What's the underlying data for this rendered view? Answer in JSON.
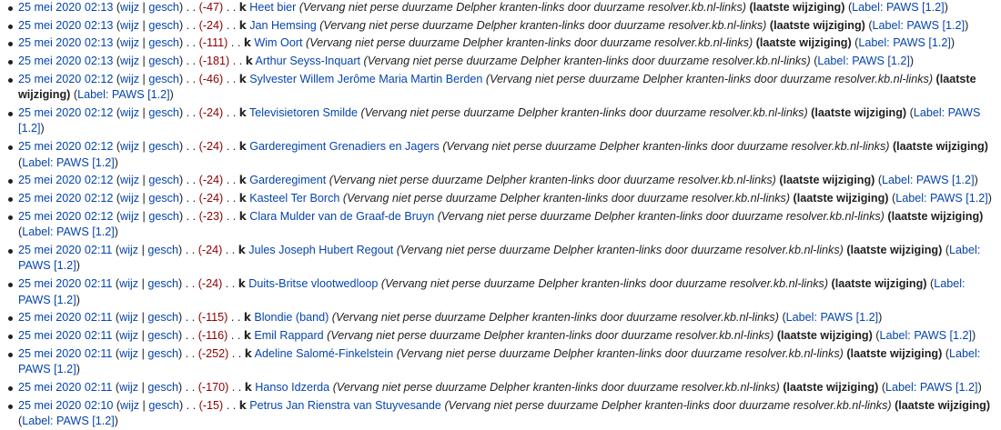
{
  "labels": {
    "diff": "wijz",
    "hist": "gesch",
    "minor": "k",
    "current": "(laatste wijziging)",
    "comment": "(Vervang niet perse duurzame Delpher kranten-links door duurzame resolver.kb.nl-links)",
    "tag_prefix": "Label:",
    "tag": "PAWS [1.2]"
  },
  "colors": {
    "link": "#0645ad",
    "negative_size": "#8b0000",
    "text": "#202122"
  },
  "contributions": [
    {
      "date": "25 mei 2020 02:13",
      "size": "(-47)",
      "page": "Heet bier",
      "current": true
    },
    {
      "date": "25 mei 2020 02:13",
      "size": "(-24)",
      "page": "Jan Hemsing",
      "current": true
    },
    {
      "date": "25 mei 2020 02:13",
      "size": "(-111)",
      "page": "Wim Oort",
      "current": true
    },
    {
      "date": "25 mei 2020 02:13",
      "size": "(-181)",
      "page": "Arthur Seyss-Inquart",
      "current": false
    },
    {
      "date": "25 mei 2020 02:12",
      "size": "(-46)",
      "page": "Sylvester Willem Jerôme Maria Martin Berden",
      "current": true
    },
    {
      "date": "25 mei 2020 02:12",
      "size": "(-24)",
      "page": "Televisietoren Smilde",
      "current": true
    },
    {
      "date": "25 mei 2020 02:12",
      "size": "(-24)",
      "page": "Garderegiment Grenadiers en Jagers",
      "current": true
    },
    {
      "date": "25 mei 2020 02:12",
      "size": "(-24)",
      "page": "Garderegiment",
      "current": true
    },
    {
      "date": "25 mei 2020 02:12",
      "size": "(-24)",
      "page": "Kasteel Ter Borch",
      "current": true
    },
    {
      "date": "25 mei 2020 02:12",
      "size": "(-23)",
      "page": "Clara Mulder van de Graaf-de Bruyn",
      "current": true
    },
    {
      "date": "25 mei 2020 02:11",
      "size": "(-24)",
      "page": "Jules Joseph Hubert Regout",
      "current": true
    },
    {
      "date": "25 mei 2020 02:11",
      "size": "(-24)",
      "page": "Duits-Britse vlootwedloop",
      "current": true
    },
    {
      "date": "25 mei 2020 02:11",
      "size": "(-115)",
      "page": "Blondie (band)",
      "current": false
    },
    {
      "date": "25 mei 2020 02:11",
      "size": "(-116)",
      "page": "Emil Rappard",
      "current": true
    },
    {
      "date": "25 mei 2020 02:11",
      "size": "(-252)",
      "page": "Adeline Salomé-Finkelstein",
      "current": true
    },
    {
      "date": "25 mei 2020 02:11",
      "size": "(-170)",
      "page": "Hanso Idzerda",
      "current": true
    },
    {
      "date": "25 mei 2020 02:10",
      "size": "(-15)",
      "page": "Petrus Jan Rienstra van Stuyvesande",
      "current": true
    }
  ]
}
